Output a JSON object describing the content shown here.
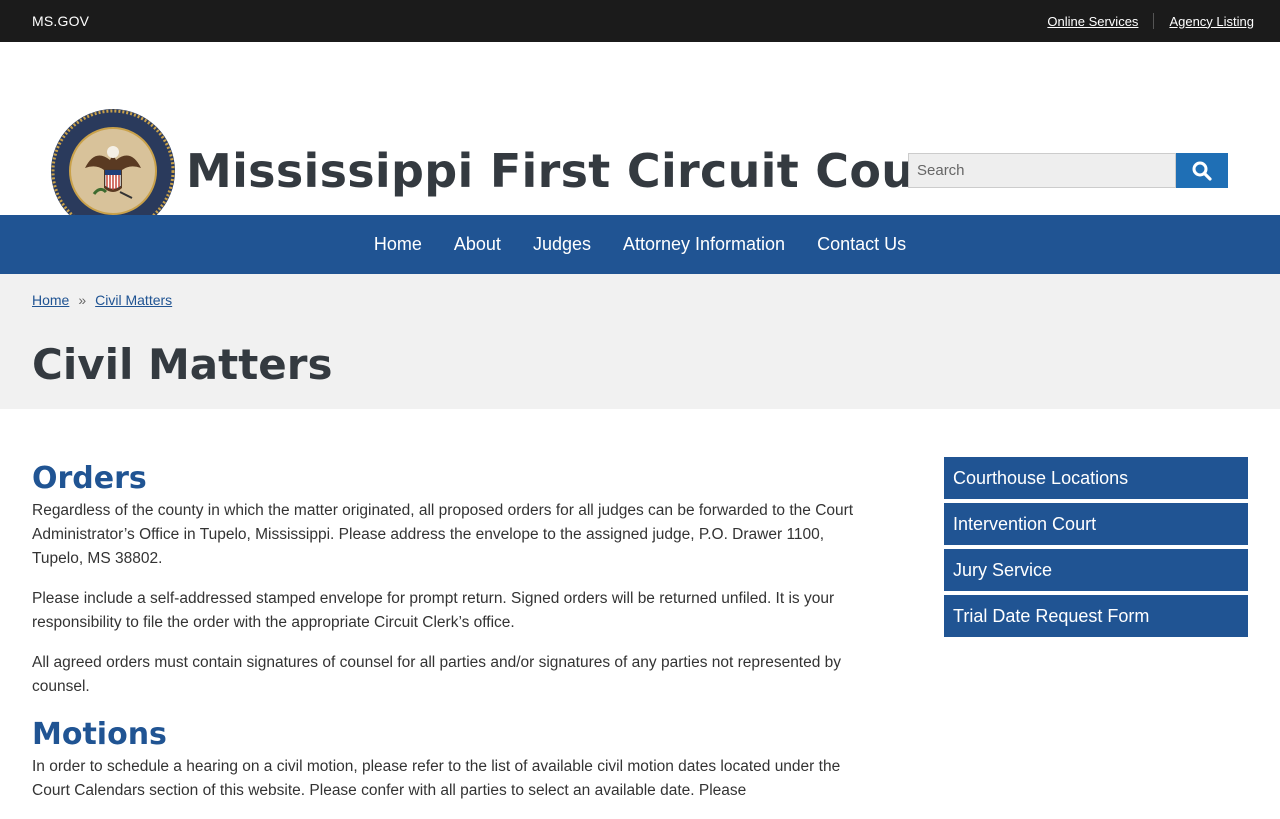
{
  "topbar": {
    "site_label": "MS.GOV",
    "links": [
      "Online Services",
      "Agency Listing"
    ]
  },
  "header": {
    "title": "Mississippi First Circuit Court",
    "seal_text": "THE GREAT SEAL OF THE STATE OF MISSISSIPPI · IN GOD WE TRUST",
    "search_placeholder": "Search"
  },
  "nav": {
    "items": [
      "Home",
      "About",
      "Judges",
      "Attorney Information",
      "Contact Us"
    ]
  },
  "breadcrumb": {
    "items": [
      "Home",
      "Civil Matters"
    ],
    "separator": "»"
  },
  "page": {
    "title": "Civil Matters"
  },
  "sections": [
    {
      "heading": "Orders",
      "paragraphs": [
        "Regardless of the county in which the matter originated, all proposed orders for all judges can be forwarded to the Court Administrator’s Office in Tupelo, Mississippi. Please address the envelope to the assigned judge, P.O. Drawer 1100, Tupelo, MS 38802.",
        "Please include a self-addressed stamped envelope for prompt return. Signed orders will be returned unfiled. It is your responsibility to file the order with the appropriate Circuit Clerk’s office.",
        "All agreed orders must contain signatures of counsel for all parties and/or signatures of any parties not represented by counsel."
      ]
    },
    {
      "heading": "Motions",
      "paragraphs": [
        "In order to schedule a hearing on a civil motion, please refer to the list of available civil motion dates located under the Court Calendars section of this website. Please confer with all parties to select an available date. Please"
      ]
    }
  ],
  "sidebar": {
    "links": [
      "Courthouse Locations",
      "Intervention Court",
      "Jury Service",
      "Trial Date Request Form"
    ]
  },
  "colors": {
    "primary_blue": "#205493",
    "search_button": "#1f6fb5",
    "topbar_bg": "#1b1b1b",
    "band_bg": "#f1f1f1"
  }
}
